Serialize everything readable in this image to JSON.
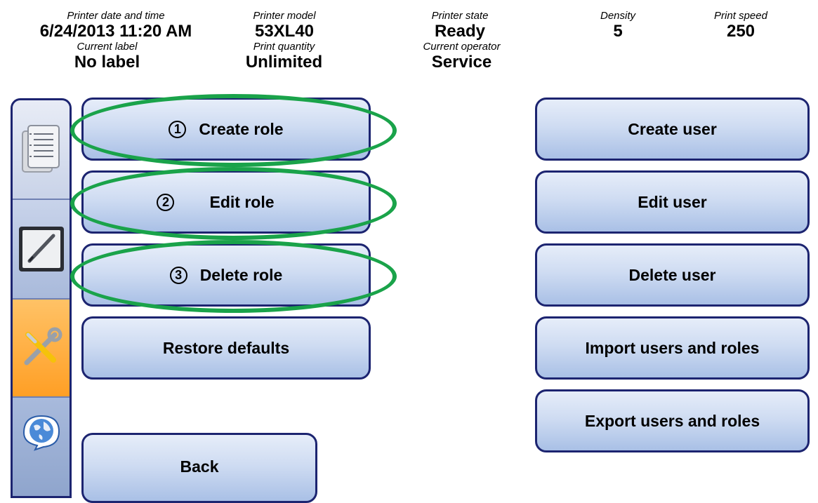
{
  "status": {
    "datetime": {
      "label": "Printer date and time",
      "value": "6/24/2013 11:20 AM"
    },
    "model": {
      "label": "Printer model",
      "value": "53XL40"
    },
    "state": {
      "label": "Printer state",
      "value": "Ready"
    },
    "density": {
      "label": "Density",
      "value": "5"
    },
    "speed": {
      "label": "Print speed",
      "value": "250"
    },
    "current_label": {
      "label": "Current label",
      "value": "No label"
    },
    "quantity": {
      "label": "Print quantity",
      "value": "Unlimited"
    },
    "operator": {
      "label": "Current operator",
      "value": "Service"
    }
  },
  "sidebar": {
    "tabs": [
      {
        "icon": "document-list-icon"
      },
      {
        "icon": "pen-edit-icon"
      },
      {
        "icon": "tools-icon",
        "active": true
      },
      {
        "icon": "globe-chat-icon"
      }
    ]
  },
  "roles": {
    "create": {
      "num": "1",
      "label": "Create role"
    },
    "edit": {
      "num": "2",
      "label": "Edit role"
    },
    "delete": {
      "num": "3",
      "label": "Delete role"
    },
    "restore": {
      "label": "Restore defaults"
    }
  },
  "users": {
    "create": "Create user",
    "edit": "Edit user",
    "delete": "Delete user",
    "import": "Import users and roles",
    "export": "Export users and roles"
  },
  "back_label": "Back",
  "colors": {
    "button_border": "#1c2470",
    "highlight": "#1aa34a",
    "active_tab": "#ff9f25"
  }
}
